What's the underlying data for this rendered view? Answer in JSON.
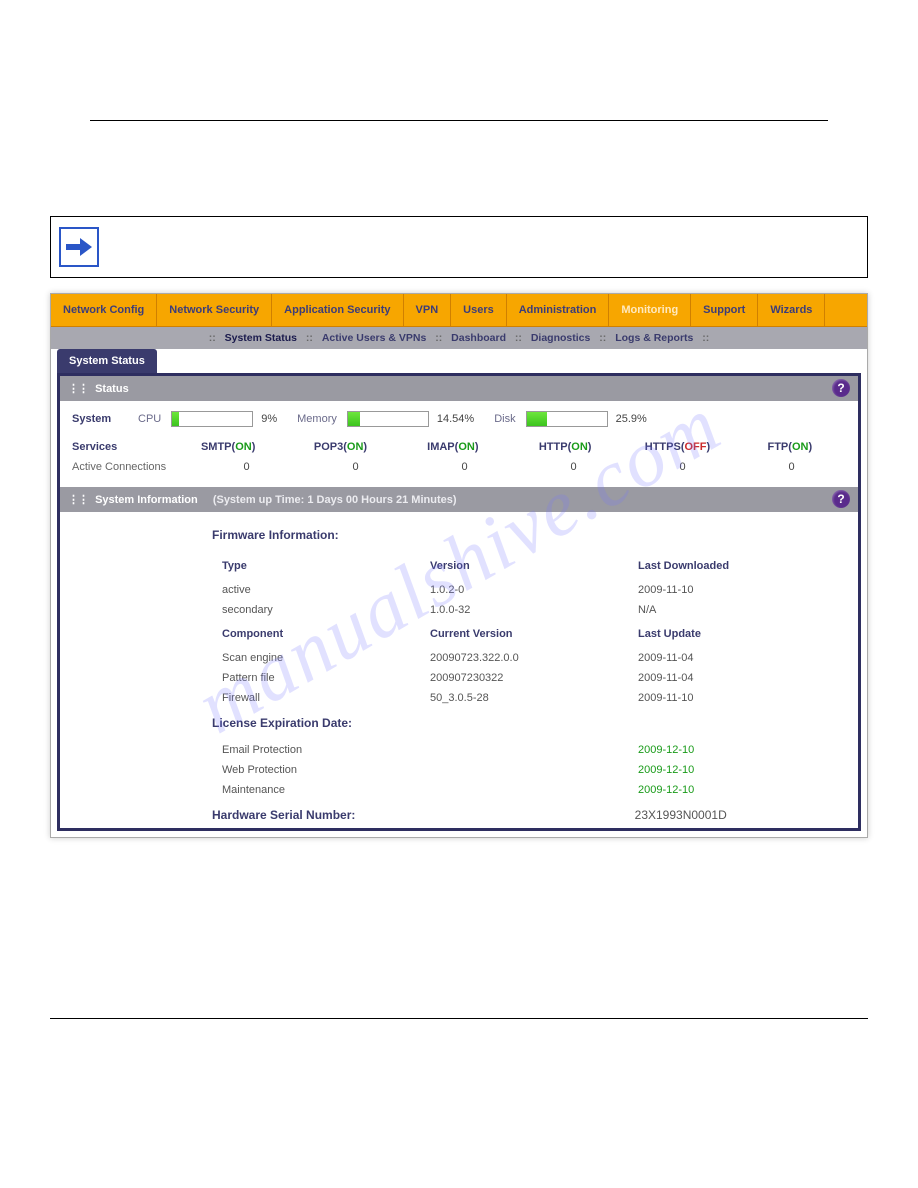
{
  "nav1": [
    "Network Config",
    "Network Security",
    "Application Security",
    "VPN",
    "Users",
    "Administration",
    "Monitoring",
    "Support",
    "Wizards"
  ],
  "nav1_active": "Monitoring",
  "nav2": {
    "items": [
      "System Status",
      "Active Users & VPNs",
      "Dashboard",
      "Diagnostics",
      "Logs & Reports"
    ]
  },
  "nav3_tab": "System Status",
  "status_panel": {
    "title": "Status",
    "system_label": "System",
    "cpu_label": "CPU",
    "cpu_pct": "9%",
    "cpu_fill_pct": 9,
    "mem_label": "Memory",
    "mem_pct": "14.54%",
    "mem_fill_pct": 14.54,
    "disk_label": "Disk",
    "disk_pct": "25.9%",
    "disk_fill_pct": 25.9,
    "services_label": "Services",
    "services": [
      {
        "name": "SMTP",
        "state": "ON"
      },
      {
        "name": "POP3",
        "state": "ON"
      },
      {
        "name": "IMAP",
        "state": "ON"
      },
      {
        "name": "HTTP",
        "state": "ON"
      },
      {
        "name": "HTTPS",
        "state": "OFF"
      },
      {
        "name": "FTP",
        "state": "ON"
      }
    ],
    "ac_label": "Active Connections",
    "ac_values": [
      "0",
      "0",
      "0",
      "0",
      "0",
      "0"
    ]
  },
  "sysinfo_panel": {
    "title": "System Information",
    "uptime": "(System up Time: 1 Days 00 Hours 21 Minutes)",
    "firmware_title": "Firmware Information:",
    "hdr1": [
      "Type",
      "Version",
      "Last Downloaded"
    ],
    "fw_rows1": [
      [
        "active",
        "1.0.2-0",
        "2009-11-10"
      ],
      [
        "secondary",
        "1.0.0-32",
        "N/A"
      ]
    ],
    "hdr2": [
      "Component",
      "Current Version",
      "Last Update"
    ],
    "fw_rows2": [
      [
        "Scan engine",
        "20090723.322.0.0",
        "2009-11-04"
      ],
      [
        "Pattern file",
        "200907230322",
        "2009-11-04"
      ],
      [
        "Firewall",
        "50_3.0.5-28",
        "2009-11-10"
      ]
    ],
    "lic_title": "License Expiration Date:",
    "lic_rows": [
      [
        "Email Protection",
        "2009-12-10"
      ],
      [
        "Web Protection",
        "2009-12-10"
      ],
      [
        "Maintenance",
        "2009-12-10"
      ]
    ],
    "serial_label": "Hardware Serial Number:",
    "serial_value": "23X1993N0001D"
  },
  "watermark": "manualshive.com"
}
